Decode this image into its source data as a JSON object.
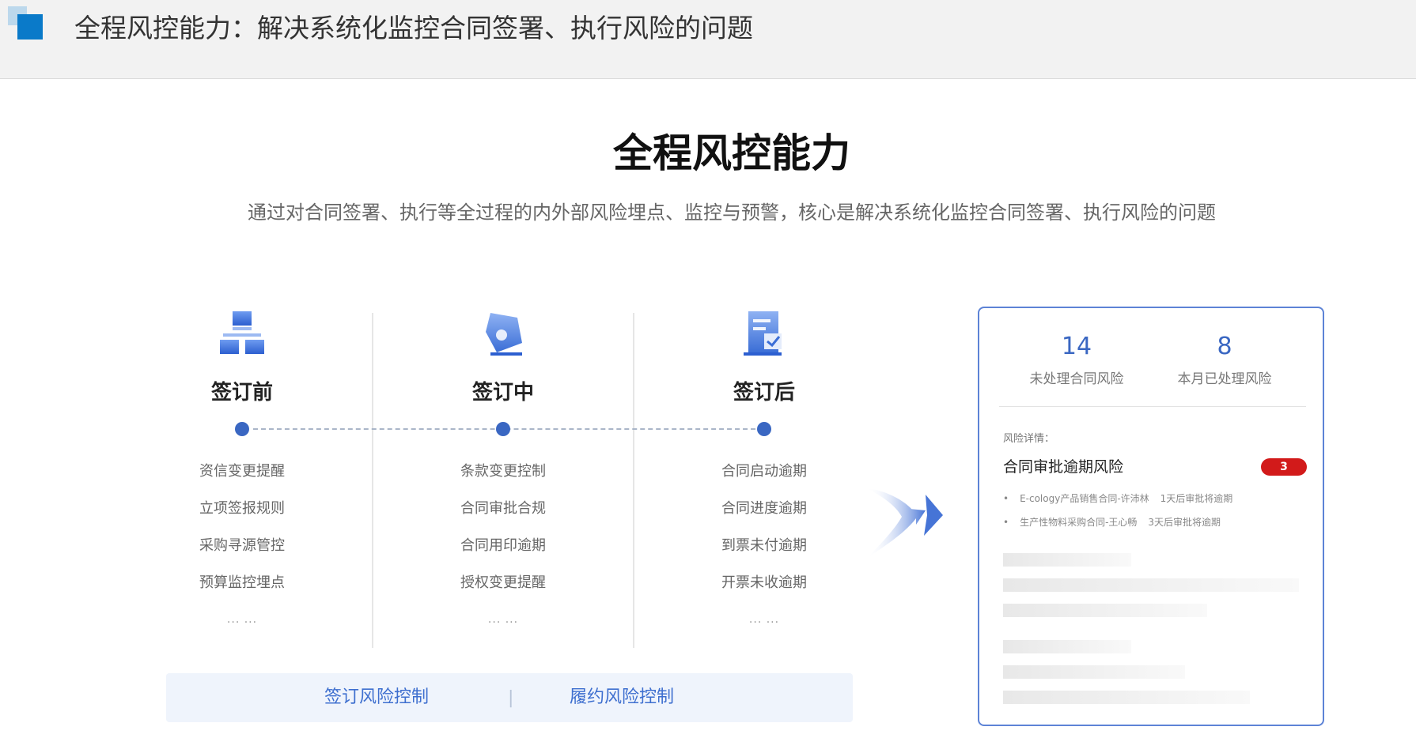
{
  "header": {
    "title": "全程风控能力：解决系统化监控合同签署、执行风险的问题"
  },
  "hero": {
    "title": "全程风控能力",
    "subtitle": "通过对合同签署、执行等全过程的内外部风险埋点、监控与预警，核心是解决系统化监控合同签署、执行风险的问题"
  },
  "stages": [
    {
      "title": "签订前",
      "icon": "org-chart-icon",
      "items": [
        "资信变更提醒",
        "立项签报规则",
        "采购寻源管控",
        "预算监控埋点"
      ],
      "more": "... ..."
    },
    {
      "title": "签订中",
      "icon": "pen-nib-icon",
      "items": [
        "条款变更控制",
        "合同审批合规",
        "合同用印逾期",
        "授权变更提醒"
      ],
      "more": "... ..."
    },
    {
      "title": "签订后",
      "icon": "document-check-icon",
      "items": [
        "合同启动逾期",
        "合同进度逾期",
        "到票未付逾期",
        "开票未收逾期"
      ],
      "more": "... ..."
    }
  ],
  "bottom_bar": {
    "left": "签订风险控制",
    "separator": "|",
    "right": "履约风险控制"
  },
  "panel": {
    "stats": [
      {
        "value": "14",
        "label": "未处理合同风险"
      },
      {
        "value": "8",
        "label": "本月已处理风险"
      }
    ],
    "details_label": "风险详情：",
    "risk": {
      "name": "合同审批逾期风险",
      "count": "3",
      "items": [
        {
          "bullet": "•",
          "text": "E-cology产品销售合同-许沛林",
          "note": "1天后审批将逾期"
        },
        {
          "bullet": "•",
          "text": "生产性物料采购合同-王心畅",
          "note": "3天后审批将逾期"
        }
      ]
    }
  },
  "colors": {
    "accent": "#3a67c2",
    "badge": "#d21a1a",
    "logo": "#0a7ac9"
  }
}
